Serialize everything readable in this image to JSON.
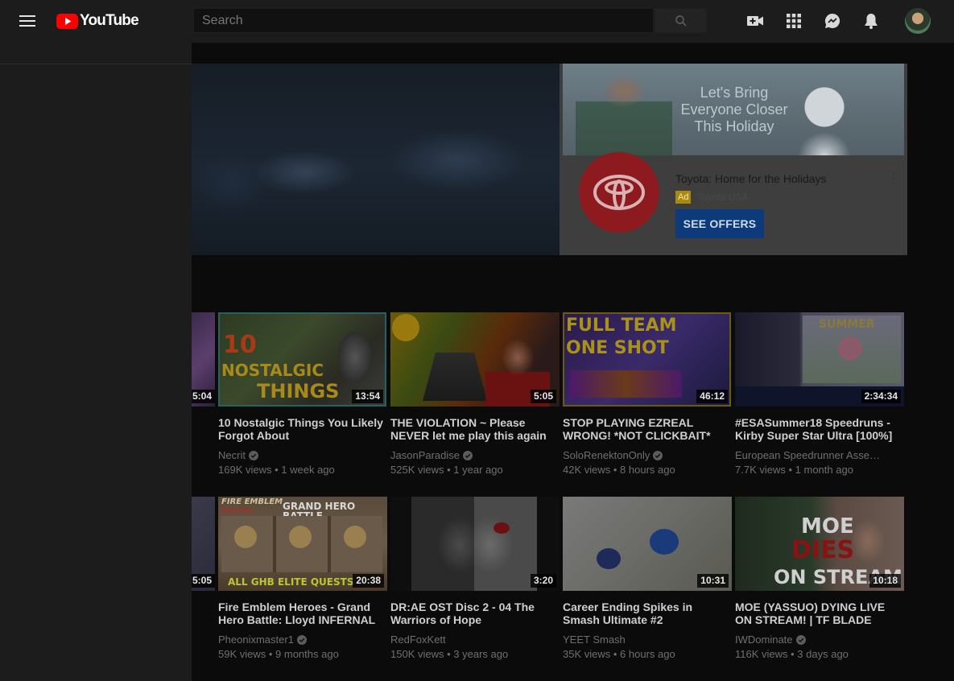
{
  "masthead": {
    "logo_text": "YouTube",
    "search_placeholder": "Search"
  },
  "ad": {
    "banner_lines": [
      "Let's Bring",
      "Everyone Closer",
      "This Holiday"
    ],
    "title": "Toyota: Home for the Holidays",
    "badge": "Ad",
    "advertiser": "Toyota USA",
    "cta": "SEE OFFERS"
  },
  "partial_durations": [
    "5:04",
    "5:05"
  ],
  "videos": [
    {
      "title": "10 Nostalgic Things You Likely Forgot About",
      "channel": "Necrit",
      "verified": true,
      "views": "169K views",
      "age": "1 week ago",
      "duration": "13:54"
    },
    {
      "title": "THE VIOLATION ~ Please NEVER let me play this again",
      "channel": "JasonParadise",
      "verified": true,
      "views": "525K views",
      "age": "1 year ago",
      "duration": "5:05"
    },
    {
      "title": "STOP PLAYING EZREAL WRONG! *NOT CLICKBAIT*",
      "channel": "SoloRenektonOnly",
      "verified": true,
      "views": "42K views",
      "age": "8 hours ago",
      "duration": "46:12"
    },
    {
      "title": "#ESASummer18 Speedruns - Kirby Super Star Ultra [100%]",
      "channel": "European Speedrunner Assembly",
      "verified": false,
      "views": "7.7K views",
      "age": "1 month ago",
      "duration": "2:34:34"
    },
    {
      "title": "Fire Emblem Heroes - Grand Hero Battle: Lloyd INFERNAL",
      "channel": "Pheonixmaster1",
      "verified": true,
      "views": "59K views",
      "age": "9 months ago",
      "duration": "20:38"
    },
    {
      "title": "DR:AE OST Disc 2 - 04 The Warriors of Hope",
      "channel": "RedFoxKett",
      "verified": false,
      "views": "150K views",
      "age": "3 years ago",
      "duration": "3:20"
    },
    {
      "title": "Career Ending Spikes in Smash Ultimate #2",
      "channel": "YEET Smash",
      "verified": false,
      "views": "35K views",
      "age": "6 hours ago",
      "duration": "10:31"
    },
    {
      "title": "MOE (YASSUO) DYING LIVE ON STREAM! | TF BLADE",
      "channel": "IWDominate",
      "verified": true,
      "views": "116K views",
      "age": "3 days ago",
      "duration": "10:18"
    }
  ],
  "thumb_text": {
    "v0": [
      "10",
      "NOSTALGIC",
      "THINGS"
    ],
    "v2": [
      "FULL TEAM",
      "ONE SHOT"
    ],
    "v3": "SUMMER",
    "v4": [
      "FIRE EMBLEM",
      "Heroes",
      "GRAND HERO BATTLE",
      "ALL GHB ELITE QUESTS"
    ],
    "v7": [
      "MOE",
      "DIES",
      "ON STREAM"
    ]
  },
  "colors": {
    "brand_red": "#ff0000",
    "ad_button": "#0d3a7a",
    "overlay_bg": "#0b0b0b"
  },
  "icons": [
    "menu-icon",
    "youtube-logo-icon",
    "search-icon",
    "create-video-icon",
    "apps-grid-icon",
    "messages-icon",
    "notifications-bell-icon",
    "avatar",
    "verified-check-icon",
    "more-vert-icon",
    "toyota-logo-icon"
  ]
}
